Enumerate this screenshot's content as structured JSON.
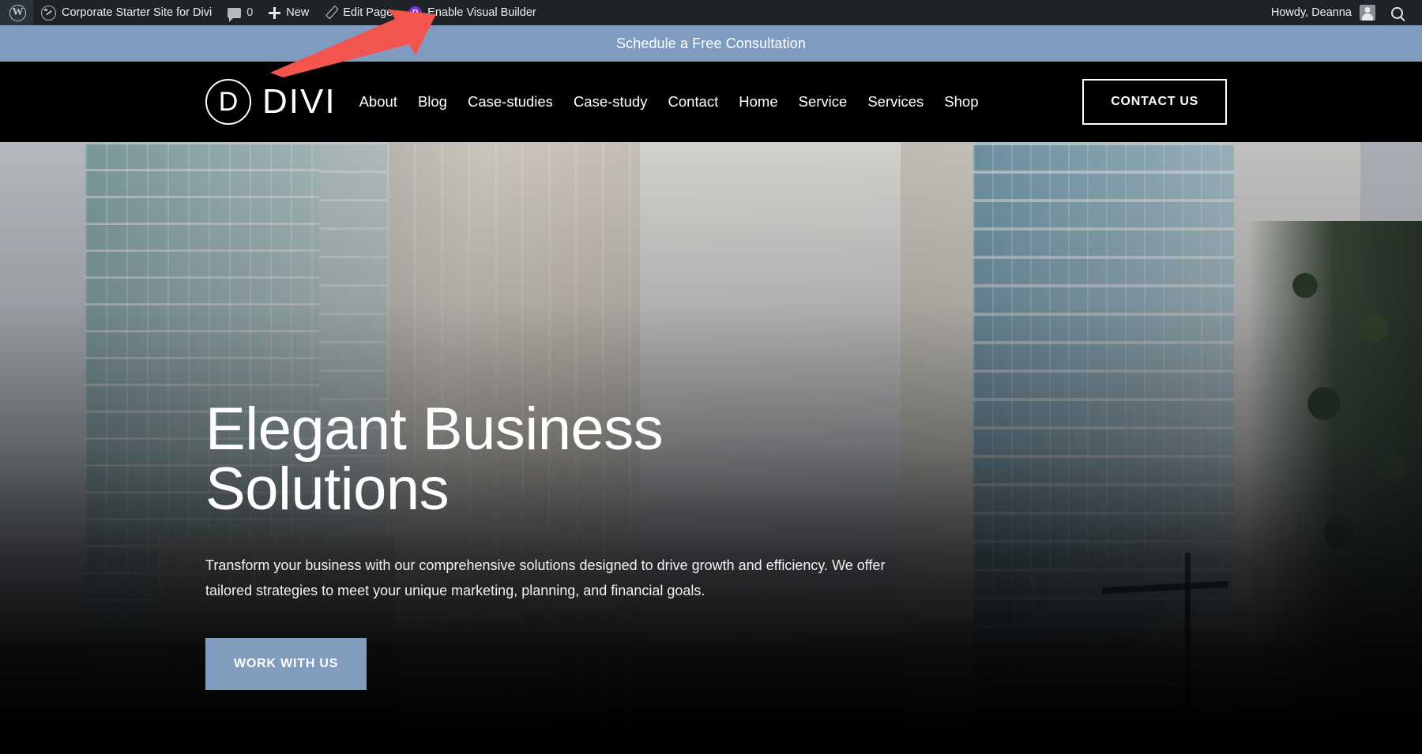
{
  "admin_bar": {
    "wp_logo_label": "W",
    "site_name": "Corporate Starter Site for Divi",
    "comment_count": "0",
    "new_label": "New",
    "edit_page_label": "Edit Page",
    "divi_badge_label": "D",
    "enable_visual_builder_label": "Enable Visual Builder",
    "howdy_label": "Howdy, Deanna",
    "background_color": "#1d2327",
    "divi_badge_color": "#7b2fe0"
  },
  "promo_bar": {
    "text": "Schedule a Free Consultation",
    "background_color": "#7f9cc0",
    "text_color": "#ffffff"
  },
  "header": {
    "brand": {
      "mark_letter": "D",
      "wordmark": "DIVI"
    },
    "nav_items": [
      {
        "label": "About"
      },
      {
        "label": "Blog"
      },
      {
        "label": "Case-studies"
      },
      {
        "label": "Case-study"
      },
      {
        "label": "Contact"
      },
      {
        "label": "Home"
      },
      {
        "label": "Service"
      },
      {
        "label": "Services"
      },
      {
        "label": "Shop"
      }
    ],
    "cta_label": "CONTACT US",
    "background_color": "#000000"
  },
  "hero": {
    "title_line1": "Elegant Business",
    "title_line2": "Solutions",
    "subtitle": "Transform your business with our comprehensive solutions designed to drive growth and efficiency. We offer tailored strategies to meet your unique marketing, planning, and financial goals.",
    "button_label": "WORK WITH US",
    "button_color": "#819cbf",
    "text_color": "#ffffff"
  },
  "annotation": {
    "arrow_color": "#f2554e",
    "points_to": "Enable Visual Builder"
  }
}
